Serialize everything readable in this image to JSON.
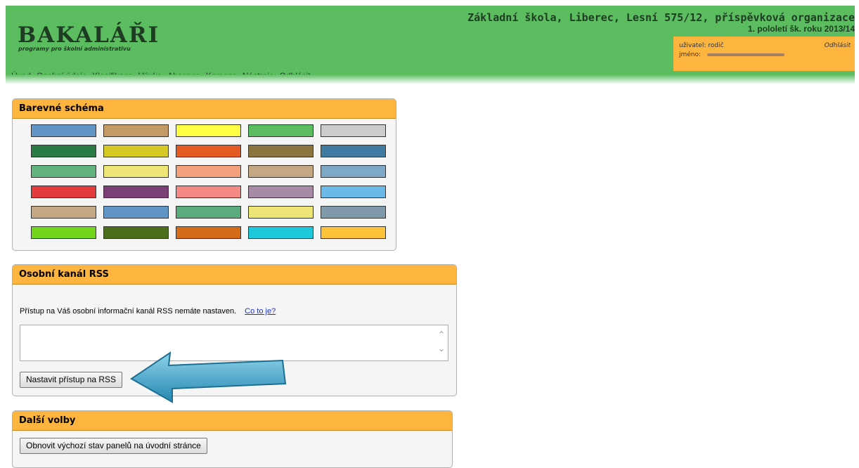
{
  "header": {
    "logo_title": "BAKALÁŘI",
    "logo_subtitle": "programy pro školní administrativu",
    "school_name": "Základní škola, Liberec, Lesní 575/12, příspěvková organizace",
    "term": "1. pololetí šk. roku 2013/14",
    "user_label": "uživatel: rodič",
    "name_label": "jméno:",
    "logout_link": "Odhlásit"
  },
  "menu": {
    "items": [
      "Úvod",
      "Osobní údaje",
      "Klasifikace",
      "Výuka",
      "Absence",
      "Komens",
      "Nástroje",
      "Odhlásit"
    ]
  },
  "color_scheme": {
    "title": "Barevné schéma",
    "swatches": [
      [
        "#6195c6",
        "#c49b66",
        "#ffff44",
        "#5cbd60",
        "#cccccc"
      ],
      [
        "#2a7a44",
        "#d6c926",
        "#e45a22",
        "#8b7440",
        "#3f7ba0"
      ],
      [
        "#63b37f",
        "#ede576",
        "#f3a07c",
        "#c4a884",
        "#7ea9c6"
      ],
      [
        "#e33b3b",
        "#7a4075",
        "#f48a86",
        "#a78aa6",
        "#6cb8e6"
      ],
      [
        "#c4a884",
        "#6195c6",
        "#5aac7c",
        "#ede576",
        "#8099ab"
      ],
      [
        "#73d61c",
        "#4a6e1c",
        "#d36b18",
        "#1ec8dc",
        "#fdc33a"
      ]
    ]
  },
  "rss": {
    "title": "Osobní kanál RSS",
    "text": "Přístup na Váš osobní informační kanál RSS nemáte nastaven.",
    "link": "Co to je?",
    "button": "Nastavit přístup na RSS"
  },
  "other": {
    "title": "Další volby",
    "button": "Obnovit výchozí stav panelů na úvodní stránce"
  },
  "colors": {
    "header_green": "#5cbd60",
    "panel_orange": "#fdb53f",
    "arrow_blue": "#3ca3c8"
  }
}
